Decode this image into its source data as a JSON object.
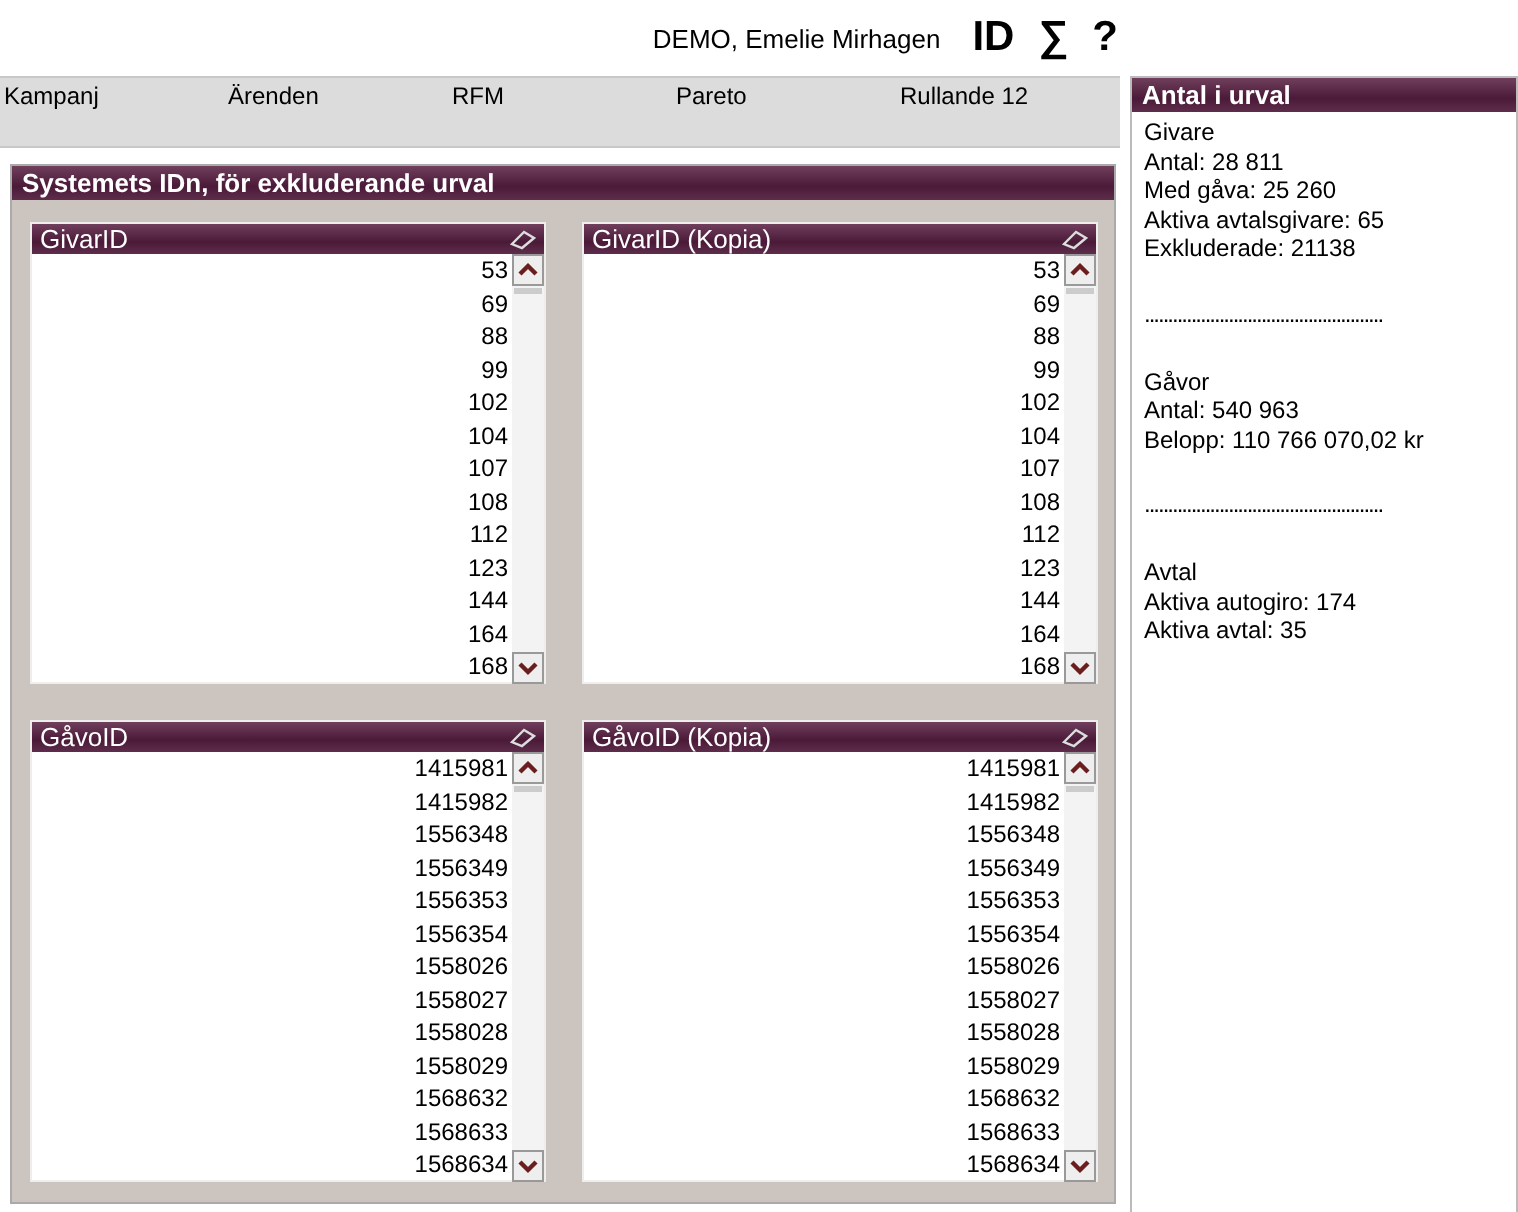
{
  "header": {
    "user": "DEMO, Emelie Mirhagen",
    "icons": [
      "ID",
      "∑",
      "?"
    ]
  },
  "tabs": [
    "Kampanj",
    "Ärenden",
    "RFM",
    "Pareto",
    "Rullande 12"
  ],
  "main_panel": {
    "title": "Systemets IDn, för exkluderande urval",
    "lists": [
      {
        "title": "GivarID",
        "values": [
          "53",
          "69",
          "88",
          "99",
          "102",
          "104",
          "107",
          "108",
          "112",
          "123",
          "144",
          "164",
          "168"
        ]
      },
      {
        "title": "GivarID (Kopia)",
        "values": [
          "53",
          "69",
          "88",
          "99",
          "102",
          "104",
          "107",
          "108",
          "112",
          "123",
          "144",
          "164",
          "168"
        ]
      },
      {
        "title": "GåvoID",
        "values": [
          "1415981",
          "1415982",
          "1556348",
          "1556349",
          "1556353",
          "1556354",
          "1558026",
          "1558027",
          "1558028",
          "1558029",
          "1568632",
          "1568633",
          "1568634"
        ]
      },
      {
        "title": "GåvoID (Kopia)",
        "values": [
          "1415981",
          "1415982",
          "1556348",
          "1556349",
          "1556353",
          "1556354",
          "1558026",
          "1558027",
          "1558028",
          "1558029",
          "1568632",
          "1568633",
          "1568634"
        ]
      }
    ]
  },
  "side_panel": {
    "title": "Antal i urval",
    "sections": [
      {
        "lines": [
          "Givare",
          "Antal: 28 811",
          "Med gåva: 25 260",
          "Aktiva avtalsgivare: 65",
          "Exkluderade: 21138"
        ]
      },
      {
        "lines": [
          "Gåvor",
          "Antal: 540 963",
          "Belopp: 110 766 070,02 kr"
        ]
      },
      {
        "lines": [
          "Avtal",
          "Aktiva autogiro: 174",
          "Aktiva avtal: 35"
        ]
      }
    ],
    "separator": "..................................................."
  }
}
